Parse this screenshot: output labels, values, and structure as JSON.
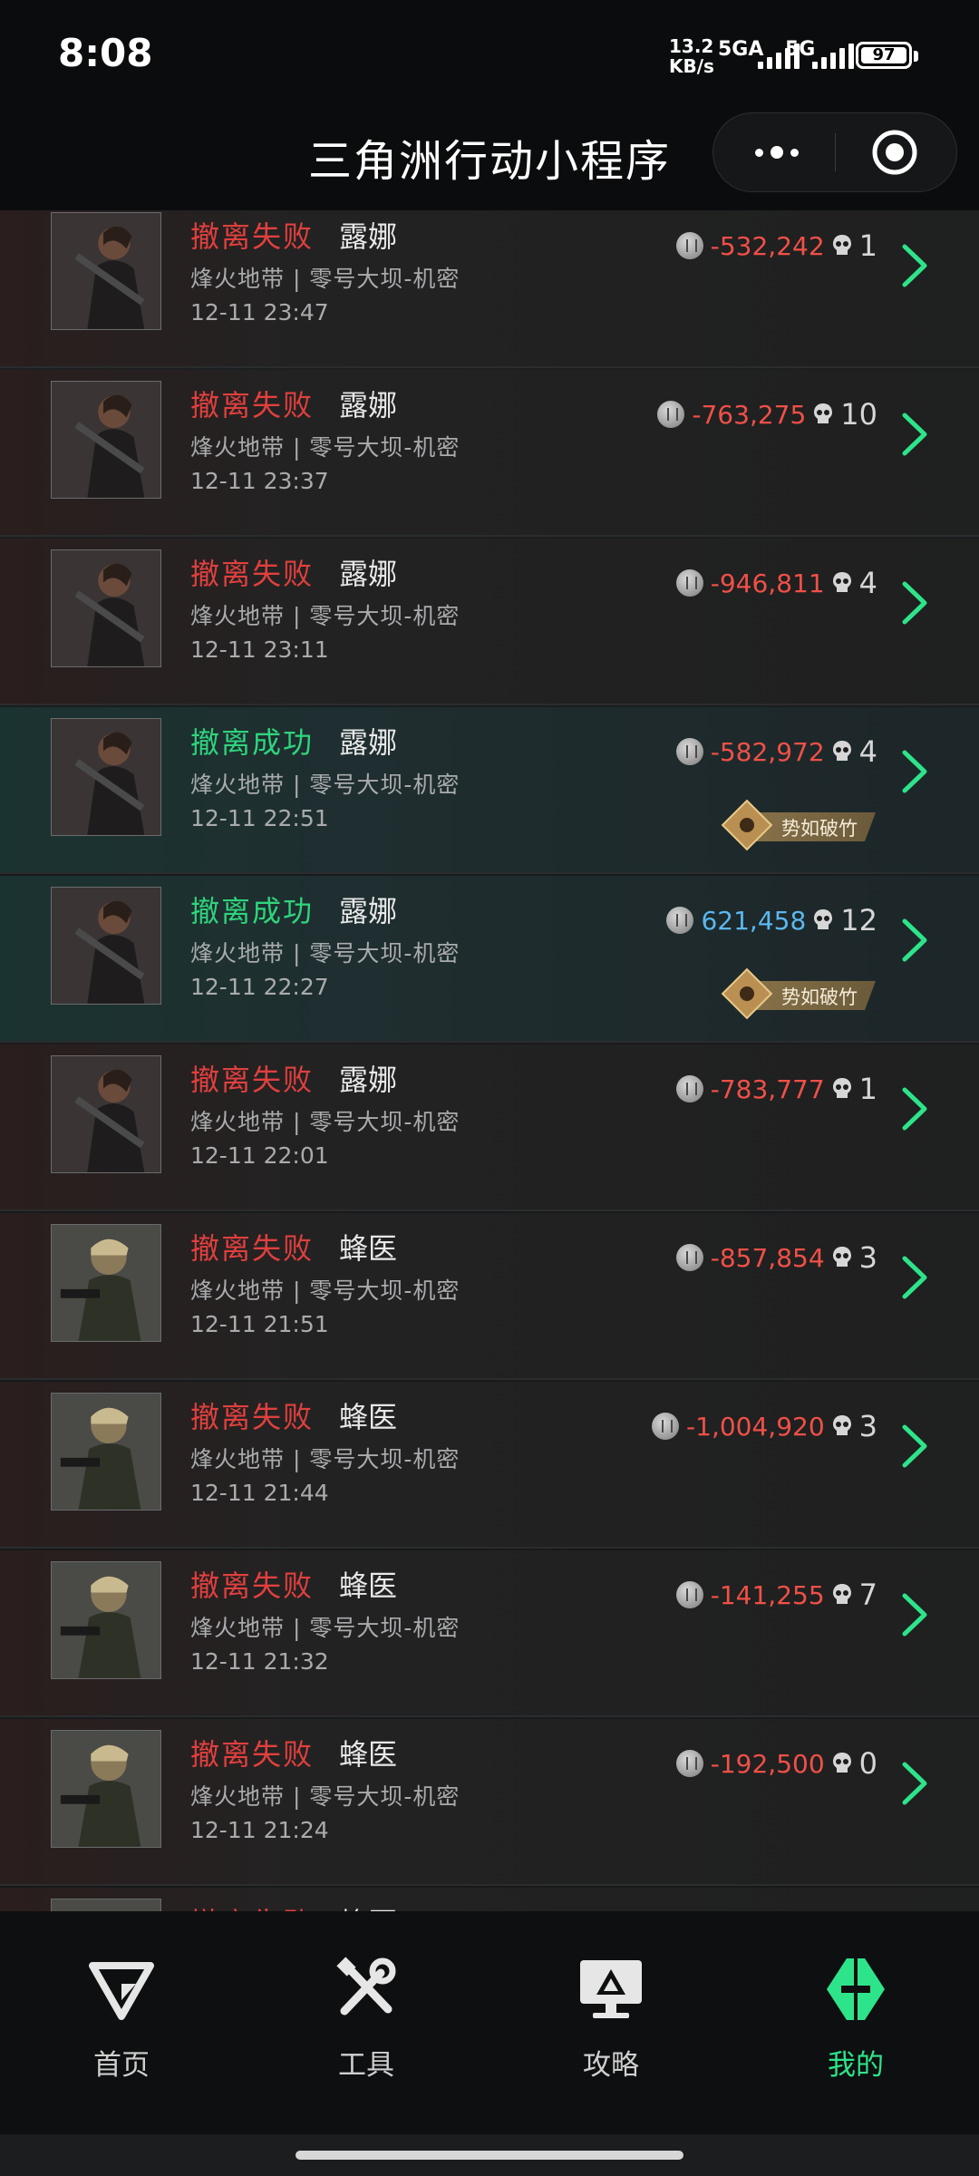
{
  "status_bar": {
    "time": "8:08",
    "net_speed": "13.2",
    "net_unit": "KB/s",
    "signal1": "5GA",
    "signal2": "5G",
    "battery": "97"
  },
  "title_bar": {
    "title": "三角洲行动小程序",
    "more_icon": "more-dots-icon",
    "close_icon": "target-close-icon"
  },
  "records": [
    {
      "result": "撤离失败",
      "status": "fail",
      "operator": "露娜",
      "map": "烽火地带 | 零号大坝-机密",
      "time": "12-11 23:47",
      "value": "-532,242",
      "kills": "1",
      "badge": ""
    },
    {
      "result": "撤离失败",
      "status": "fail",
      "operator": "露娜",
      "map": "烽火地带 | 零号大坝-机密",
      "time": "12-11 23:37",
      "value": "-763,275",
      "kills": "10",
      "badge": ""
    },
    {
      "result": "撤离失败",
      "status": "fail",
      "operator": "露娜",
      "map": "烽火地带 | 零号大坝-机密",
      "time": "12-11 23:11",
      "value": "-946,811",
      "kills": "4",
      "badge": ""
    },
    {
      "result": "撤离成功",
      "status": "success",
      "operator": "露娜",
      "map": "烽火地带 | 零号大坝-机密",
      "time": "12-11 22:51",
      "value": "-582,972",
      "kills": "4",
      "badge": "势如破竹"
    },
    {
      "result": "撤离成功",
      "status": "success",
      "operator": "露娜",
      "map": "烽火地带 | 零号大坝-机密",
      "time": "12-11 22:27",
      "value": "621,458",
      "kills": "12",
      "badge": "势如破竹"
    },
    {
      "result": "撤离失败",
      "status": "fail",
      "operator": "露娜",
      "map": "烽火地带 | 零号大坝-机密",
      "time": "12-11 22:01",
      "value": "-783,777",
      "kills": "1",
      "badge": ""
    },
    {
      "result": "撤离失败",
      "status": "fail",
      "operator": "蜂医",
      "map": "烽火地带 | 零号大坝-机密",
      "time": "12-11 21:51",
      "value": "-857,854",
      "kills": "3",
      "badge": ""
    },
    {
      "result": "撤离失败",
      "status": "fail",
      "operator": "蜂医",
      "map": "烽火地带 | 零号大坝-机密",
      "time": "12-11 21:44",
      "value": "-1,004,920",
      "kills": "3",
      "badge": ""
    },
    {
      "result": "撤离失败",
      "status": "fail",
      "operator": "蜂医",
      "map": "烽火地带 | 零号大坝-机密",
      "time": "12-11 21:32",
      "value": "-141,255",
      "kills": "7",
      "badge": ""
    },
    {
      "result": "撤离失败",
      "status": "fail",
      "operator": "蜂医",
      "map": "烽火地带 | 零号大坝-机密",
      "time": "12-11 21:24",
      "value": "-192,500",
      "kills": "0",
      "badge": ""
    },
    {
      "result": "撤离失败",
      "status": "fail",
      "operator": "蜂医",
      "map": "",
      "time": "",
      "value": "",
      "kills": "",
      "badge": ""
    }
  ],
  "colors": {
    "fail": "#e0403e",
    "success": "#2fd47c",
    "negative_value": "#f05048",
    "positive_value": "#5ab8f0",
    "active_tab": "#2ee48a"
  },
  "nav": [
    {
      "label": "首页",
      "icon": "delta-logo-icon",
      "active": false
    },
    {
      "label": "工具",
      "icon": "tools-icon",
      "active": false
    },
    {
      "label": "攻略",
      "icon": "guide-monitor-icon",
      "active": false
    },
    {
      "label": "我的",
      "icon": "profile-emblem-icon",
      "active": true
    }
  ]
}
